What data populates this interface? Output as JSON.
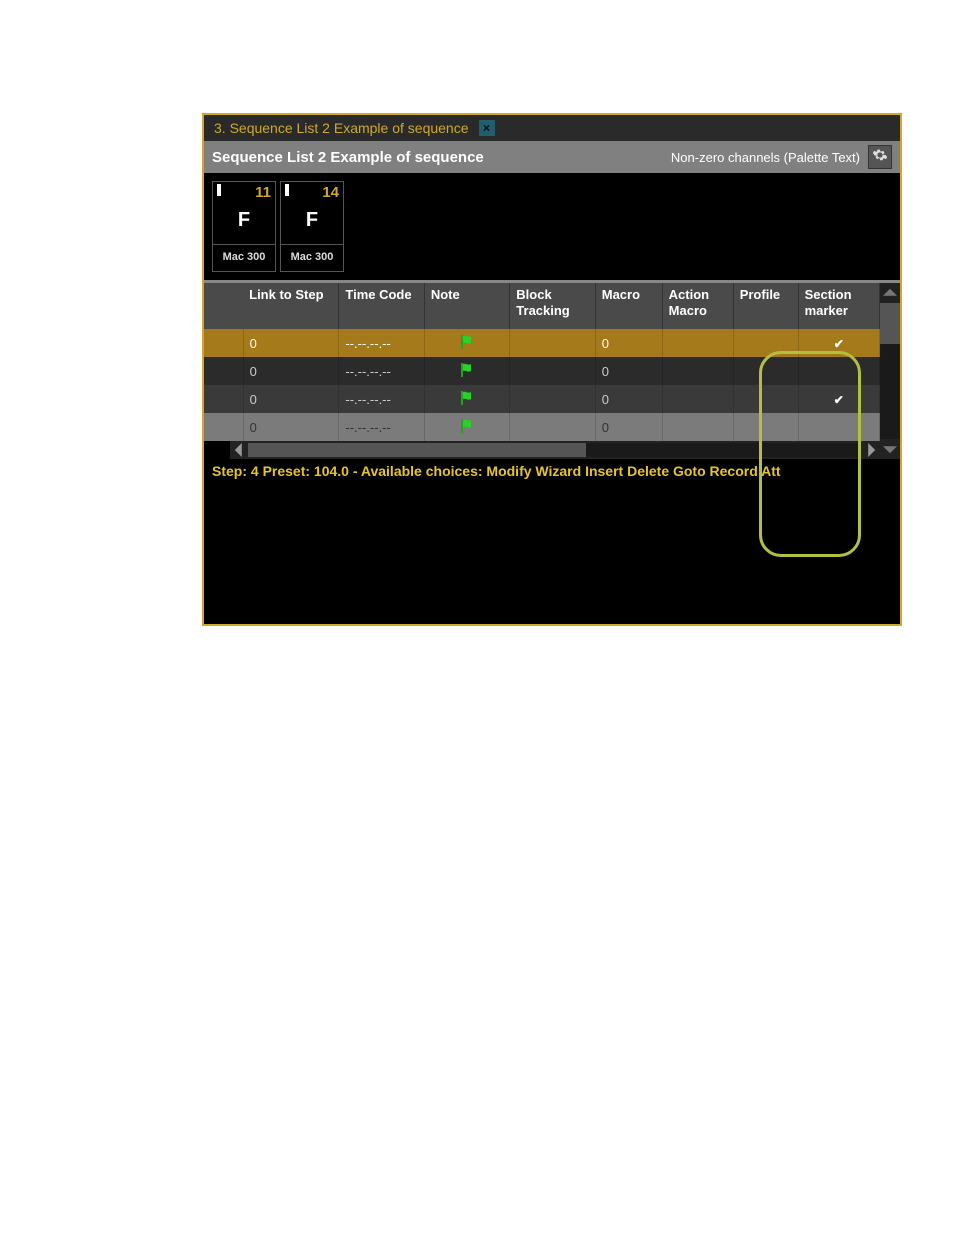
{
  "tab": {
    "title": "3. Sequence List 2 Example of sequence",
    "close_glyph": "×"
  },
  "header": {
    "title": "Sequence List 2 Example of sequence",
    "mode": "Non-zero channels (Palette Text)"
  },
  "channels": [
    {
      "number": "11",
      "level": "F",
      "label": "Mac 300"
    },
    {
      "number": "14",
      "level": "F",
      "label": "Mac 300"
    }
  ],
  "table": {
    "columns": {
      "link_to_step": "Link to Step",
      "time_code": "Time Code",
      "note": "Note",
      "block_tracking": "Block Tracking",
      "macro": "Macro",
      "action_macro": "Action Macro",
      "profile": "Profile",
      "section_marker": "Section marker"
    },
    "rows": [
      {
        "link_to_step": "0",
        "time_code": "--.--.--.--",
        "note_flag": true,
        "block_tracking": "",
        "macro": "0",
        "action_macro": "",
        "profile": "",
        "section_marker": true,
        "selected": true,
        "shade": "selected"
      },
      {
        "link_to_step": "0",
        "time_code": "--.--.--.--",
        "note_flag": true,
        "block_tracking": "",
        "macro": "0",
        "action_macro": "",
        "profile": "",
        "section_marker": false,
        "selected": false,
        "shade": "dark"
      },
      {
        "link_to_step": "0",
        "time_code": "--.--.--.--",
        "note_flag": true,
        "block_tracking": "",
        "macro": "0",
        "action_macro": "",
        "profile": "",
        "section_marker": true,
        "selected": false,
        "shade": "mid"
      },
      {
        "link_to_step": "0",
        "time_code": "--.--.--.--",
        "note_flag": true,
        "block_tracking": "",
        "macro": "0",
        "action_macro": "",
        "profile": "",
        "section_marker": false,
        "selected": false,
        "shade": "light"
      }
    ]
  },
  "status": "Step: 4 Preset: 104.0 - Available choices: Modify Wizard Insert Delete Goto Record Att",
  "glyphs": {
    "check": "✔"
  }
}
